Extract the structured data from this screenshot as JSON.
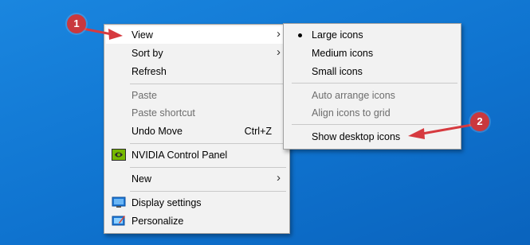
{
  "main_menu": {
    "items": [
      {
        "label": "View",
        "has_submenu": true,
        "highlighted": true,
        "enabled": true
      },
      {
        "label": "Sort by",
        "has_submenu": true,
        "enabled": true
      },
      {
        "label": "Refresh",
        "enabled": true
      },
      {
        "label": "Paste",
        "enabled": false
      },
      {
        "label": "Paste shortcut",
        "enabled": false
      },
      {
        "label": "Undo Move",
        "shortcut": "Ctrl+Z",
        "enabled": true
      },
      {
        "label": "NVIDIA Control Panel",
        "icon": "nvidia-icon",
        "enabled": true
      },
      {
        "label": "New",
        "has_submenu": true,
        "enabled": true
      },
      {
        "label": "Display settings",
        "icon": "display-icon",
        "enabled": true
      },
      {
        "label": "Personalize",
        "icon": "personalize-icon",
        "enabled": true
      }
    ]
  },
  "view_submenu": {
    "items": [
      {
        "label": "Large icons",
        "selected": true,
        "enabled": true
      },
      {
        "label": "Medium icons",
        "enabled": true
      },
      {
        "label": "Small icons",
        "enabled": true
      },
      {
        "label": "Auto arrange icons",
        "enabled": false
      },
      {
        "label": "Align icons to grid",
        "enabled": false
      },
      {
        "label": "Show desktop icons",
        "enabled": true
      }
    ]
  },
  "callouts": {
    "one": "1",
    "two": "2"
  },
  "colors": {
    "desktop": "#1478d2",
    "menu_bg": "#f2f2f2",
    "callout": "#c9383e",
    "disabled_text": "#6d6d6d"
  }
}
